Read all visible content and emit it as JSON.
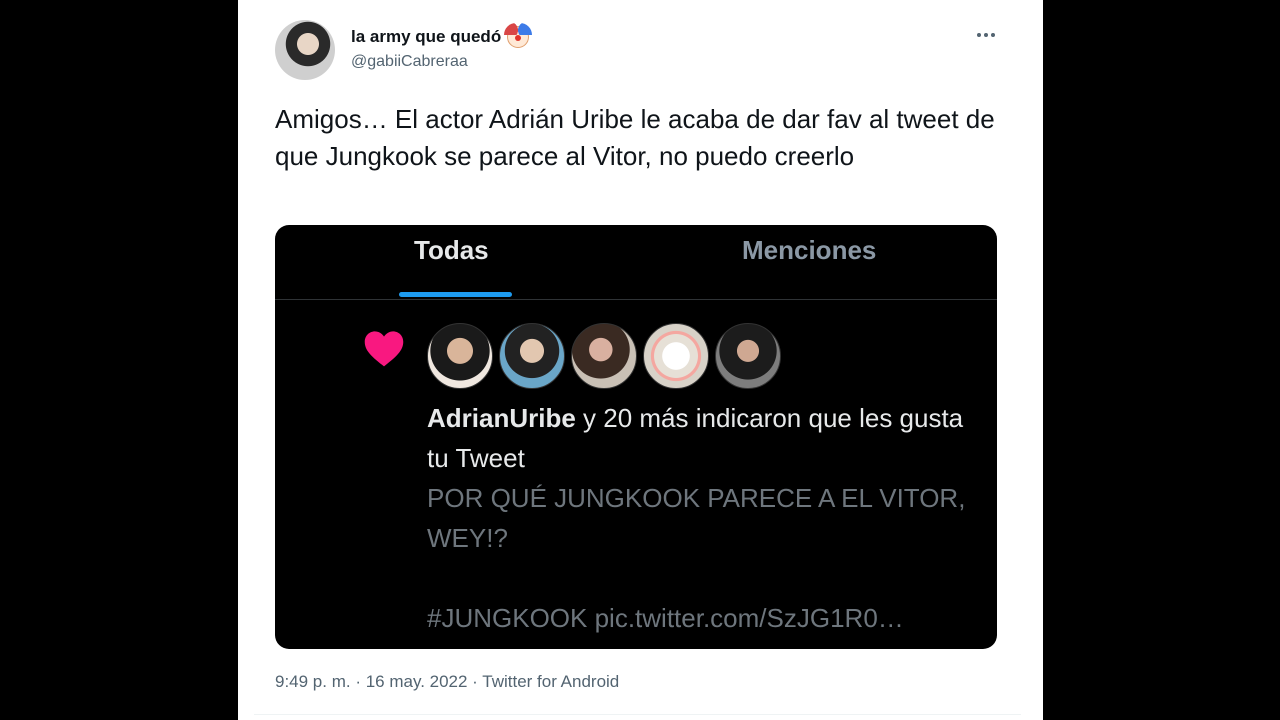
{
  "author": {
    "display_name": "la army que quedó",
    "name_emoji": "clown-face-icon",
    "handle": "@gabiiCabreraa"
  },
  "tweet": {
    "text": "Amigos… El actor Adrián Uribe le acaba de dar fav al tweet de que Jungkook se parece al Vitor, no puedo creerlo",
    "timestamp": "9:49 p. m. · 16 may. 2022 · Twitter for Android"
  },
  "screenshot": {
    "tabs": [
      {
        "label": "Todas",
        "active": true
      },
      {
        "label": "Menciones",
        "active": false
      }
    ],
    "notification": {
      "username": "AdrianUribe",
      "action": " y 20 más indicaron que les gusta tu Tweet",
      "quoted": "POR QUÉ JUNGKOOK PARECE A EL VITOR, WEY!?\n\n#JUNGKOOK pic.twitter.com/SzJG1R0…"
    }
  },
  "colors": {
    "heart": "#f91880",
    "tab_indicator": "#1d9bf0"
  }
}
